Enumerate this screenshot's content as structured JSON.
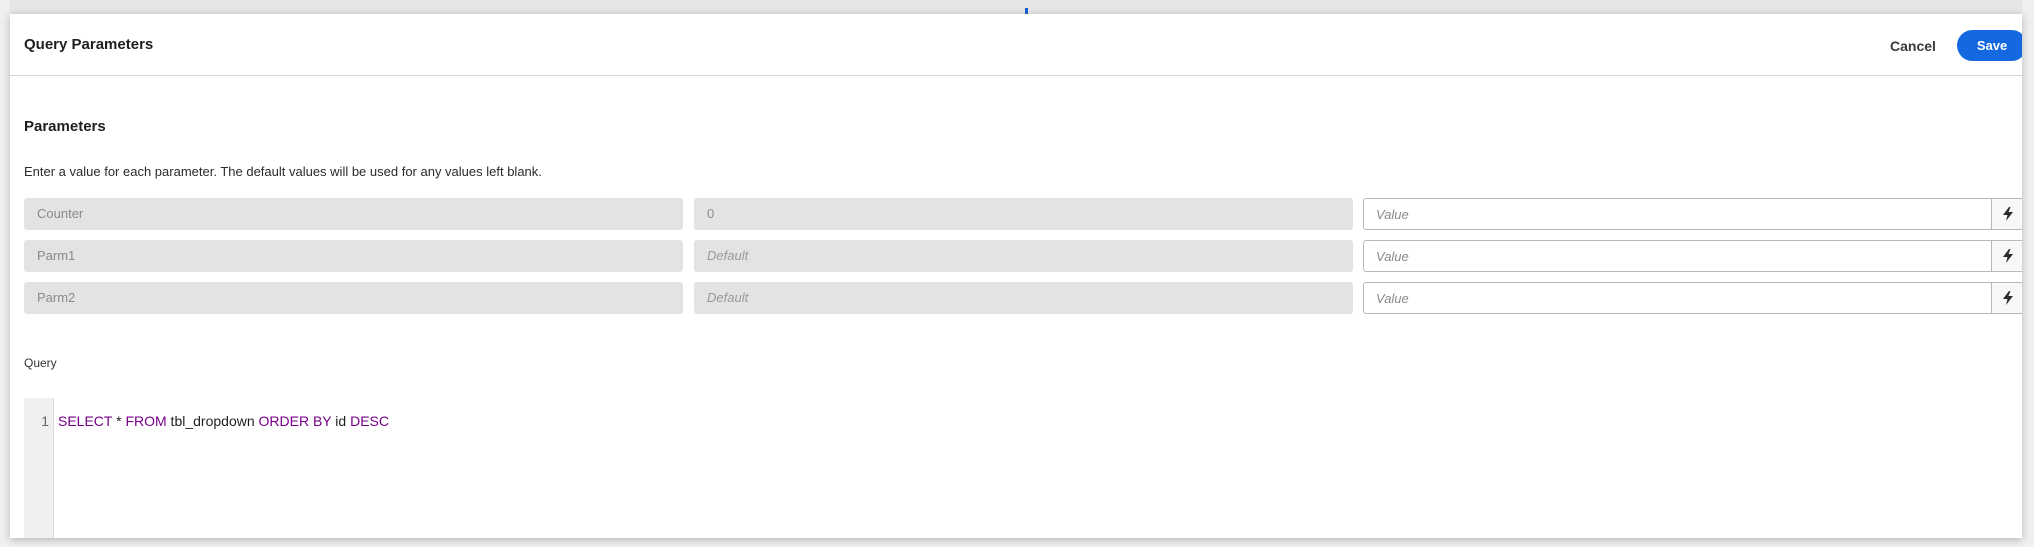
{
  "dialog": {
    "title": "Query Parameters",
    "cancel_label": "Cancel",
    "save_label": "Save"
  },
  "parameters": {
    "heading": "Parameters",
    "description": "Enter a value for each parameter. The default values will be used for any values left blank.",
    "value_placeholder": "Value",
    "rows": [
      {
        "name": "Counter",
        "default": "0"
      },
      {
        "name": "Parm1",
        "default": "Default"
      },
      {
        "name": "Parm2",
        "default": "Default"
      }
    ],
    "action_icon": "lightning-bolt-icon"
  },
  "query": {
    "label": "Query",
    "line_number": "1",
    "tokens": {
      "select": "SELECT",
      "star": " * ",
      "from": "FROM",
      "table": " tbl_dropdown ",
      "order_by": "ORDER BY",
      "column": " id ",
      "desc": "DESC"
    }
  },
  "colors": {
    "accent": "#1469e0",
    "keyword": "#770088"
  }
}
